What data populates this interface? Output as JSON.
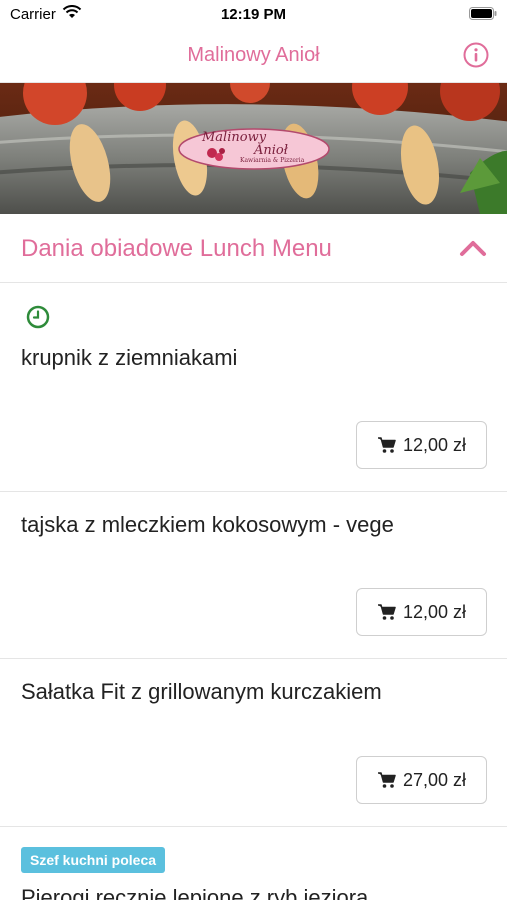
{
  "status_bar": {
    "carrier": "Carrier",
    "time": "12:19 PM"
  },
  "nav": {
    "title": "Malinowy Anioł"
  },
  "banner": {
    "logo_line1": "Malinowy",
    "logo_line2": "Anioł",
    "logo_sub": "Kawiarnia & Pizzeria"
  },
  "section": {
    "title": "Dania obiadowe Lunch Menu"
  },
  "items": [
    {
      "name": "krupnik z ziemniakami",
      "price": "12,00 zł"
    },
    {
      "name": "tajska z mleczkiem kokosowym - vege",
      "price": "12,00 zł"
    },
    {
      "name": "Sałatka Fit z grillowanym kurczakiem",
      "price": "27,00 zł"
    },
    {
      "badge": "Szef kuchni poleca",
      "name": "Pierogi ręcznie lepione z ryb jeziora"
    }
  ],
  "colors": {
    "accent": "#e06d9a",
    "badge": "#5bc0de",
    "clock": "#2e8b3a"
  }
}
